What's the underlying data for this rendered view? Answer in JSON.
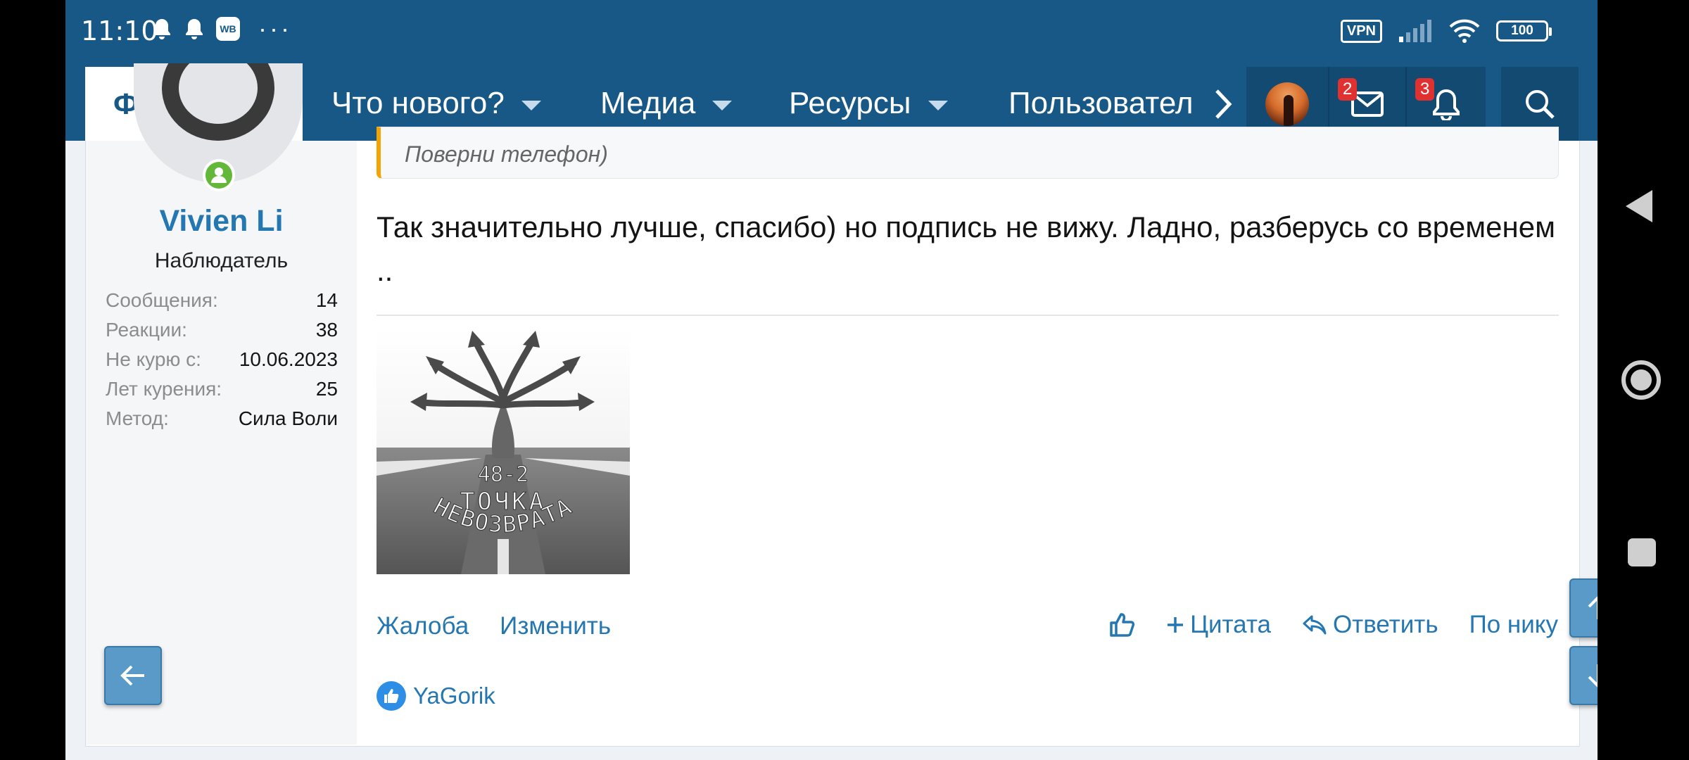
{
  "status_bar": {
    "time": "11:10",
    "wb_label": "WB",
    "dots": "···",
    "vpn_label": "VPN",
    "battery": "100"
  },
  "nav": {
    "forums": "Форумы",
    "whats_new": "Что нового?",
    "media": "Медиа",
    "resources": "Ресурсы",
    "members": "Пользовател",
    "inbox_badge": "2",
    "alerts_badge": "3"
  },
  "user": {
    "name": "Vivien Li",
    "title": "Наблюдатель",
    "stats": [
      {
        "label": "Сообщения:",
        "value": "14"
      },
      {
        "label": "Реакции:",
        "value": "38"
      },
      {
        "label": "Не курю с:",
        "value": "10.06.2023"
      },
      {
        "label": "Лет курения:",
        "value": "25"
      },
      {
        "label": "Метод:",
        "value": "Сила Воли"
      }
    ]
  },
  "post": {
    "quote": "Поверни телефон)",
    "body": "Так значительно лучше, спасибо) но подпись не вижу. Ладно, разберусь со временем ..",
    "signature": {
      "line1": "48-2",
      "line2": "ТОЧКА",
      "line3": "НЕВОЗВРАТА"
    }
  },
  "actions": {
    "report": "Жалоба",
    "edit": "Изменить",
    "quote": "Цитата",
    "reply": "Ответить",
    "by_nick": "По нику"
  },
  "reactions": {
    "user": "YaGorik"
  },
  "colors": {
    "header": "#185886",
    "link": "#2577b1",
    "accent": "#f5a300"
  }
}
